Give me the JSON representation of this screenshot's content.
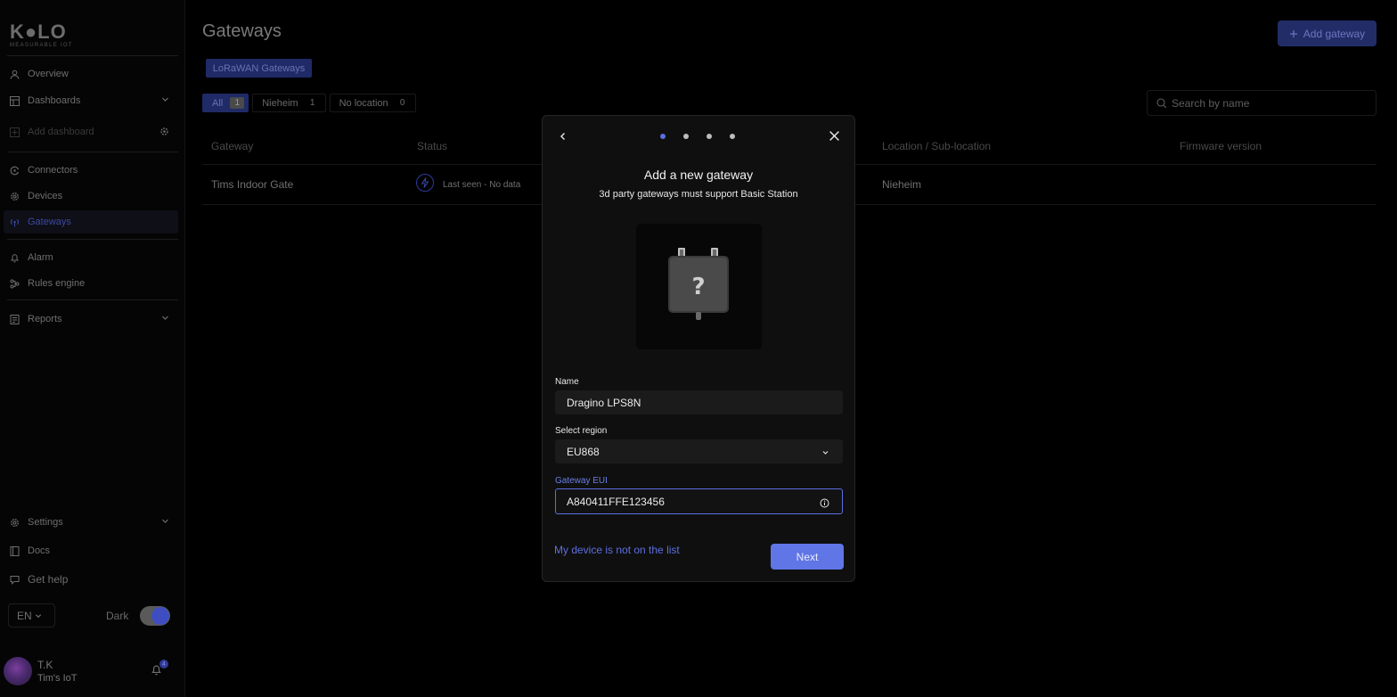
{
  "brand": {
    "logo_text": "K●LO",
    "logo_sub": "MEASURABLE IOT"
  },
  "sidebar": {
    "items": [
      {
        "label": "Overview",
        "icon": "user-icon"
      },
      {
        "label": "Dashboards",
        "icon": "dashboard-icon"
      },
      {
        "label": "Add dashboard",
        "icon": "plus-icon"
      },
      {
        "label": "Connectors",
        "icon": "connectors-icon"
      },
      {
        "label": "Devices",
        "icon": "gear-icon"
      },
      {
        "label": "Gateways",
        "icon": "antenna-icon"
      },
      {
        "label": "Alarm",
        "icon": "bell-icon"
      },
      {
        "label": "Rules engine",
        "icon": "rules-icon"
      },
      {
        "label": "Reports",
        "icon": "report-icon"
      },
      {
        "label": "Settings",
        "icon": "gear-icon"
      },
      {
        "label": "Docs",
        "icon": "book-icon"
      },
      {
        "label": "Get help",
        "icon": "chat-icon"
      }
    ],
    "active": "Gateways",
    "language": "EN",
    "dark_label": "Dark",
    "user": {
      "name": "T.K",
      "org": "Tim's IoT",
      "notifications": "4"
    }
  },
  "main": {
    "title": "Gateways",
    "add_button": "Add gateway",
    "tab": "LoRaWAN Gateways",
    "filters": [
      {
        "label": "All",
        "count": "1"
      },
      {
        "label": "Nieheim",
        "count": "1"
      },
      {
        "label": "No location",
        "count": "0"
      }
    ],
    "search_placeholder": "Search by name",
    "columns": [
      "Gateway",
      "Status",
      "Location / Sub-location",
      "Firmware version"
    ],
    "rows": [
      {
        "gateway": "Tims Indoor Gate",
        "status": "Last seen - No data",
        "location": "Nieheim",
        "firmware": ""
      }
    ]
  },
  "modal": {
    "title": "Add a new gateway",
    "subtitle": "3d party gateways must support Basic Station",
    "step_current": 1,
    "step_total": 4,
    "name_label": "Name",
    "name_value": "Dragino LPS8N",
    "region_label": "Select region",
    "region_value": "EU868",
    "eui_label": "Gateway EUI",
    "eui_value": "A840411FFE123456",
    "not_on_list": "My device is not on the list",
    "next": "Next"
  },
  "colors": {
    "accent": "#6075e6",
    "accent_dim": "#1f2a66"
  }
}
